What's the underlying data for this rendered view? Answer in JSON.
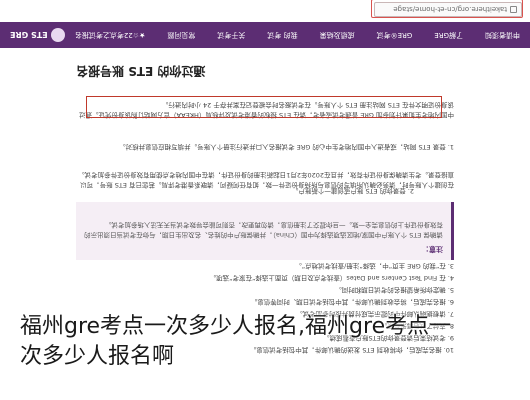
{
  "browser": {
    "url": "takeithere.org/cn-et-home/stage"
  },
  "nav": {
    "logo_text": "ETS GRE",
    "items": [
      "申请者须知",
      "了解GRE",
      "GRE®考试",
      "成绩及结果",
      "我的 考试",
      "关于考试",
      "常见问题",
      "★☆22考点之考试报名"
    ]
  },
  "content": {
    "title": "通过你的 ETS 账号报名",
    "para1": "中国内地考生如果计划参加 GRE 普通考试或者考，请在 ETS 授权的香港考试及评核局（HKEAA）官方网站订购该身份凭证。通过该身份证明文件在 ETS 网站注册 ETS 个人账号。在考试报名时会被登记在案并存于 24 小时内进行。",
    "para2": "1. 登录 ETS 网站，或者进入中国内地考生中心的 GRE 考试报名入口并进行注册个人账号。并填写相应信息并核对。",
    "para3": "在创建个人账号时，请务必确认所填写的信息与所持身份证件一致，如有任何疑问，请联系香港考评局。若您已有 ETS 账号，可以直接登录。考生请确保身份证件有效，并且在2020年2月1日起新注册的身份证件，请在中国内地考点使用有效身份证件参加考试。",
    "para4": "2. 登录你的 ETS 账户或创建一个新账户。",
    "note_title": "注意：",
    "note_text": "请确保 ETS 个人账户中国家/地区选项选择为中国（China），并确保账户中的姓名、名及出生日期，与你在考试当日须出示的有效身份证件上的信息完全一致。一旦你提交了注册信息，请勿再更改，否则可能会导致考试当天无法入场参加考试。",
    "step3": "3. 在“我的 GRE 主页”中，选择“注册/查找考试地点”。",
    "step4": "4. 在 Find Test Centers and Dates（查找考点及日期）页面上选择“在家考”选项。",
    "step5": "5. 确定你所希望报名的考试日期和时间。",
    "step6": "6. 报名完成后，将会收到确认邮件，其中包括考试日期、时间等信息。",
    "step7": "7. 请根据确认邮件中的提示完成付费并按时参加考试。",
    "step8": "8. 支付了以后再来登录。",
    "step9": "9. 考试结束后请登录你的ETS账户查看成绩。",
    "step10": "10. 报名完成后，你将收到 ETS 发送的确认邮件，其中包括考试信息。"
  },
  "caption": {
    "line1": "福州gre考点一次多少人报名,福州gre考点一",
    "line2": "次多少人报名啊"
  }
}
